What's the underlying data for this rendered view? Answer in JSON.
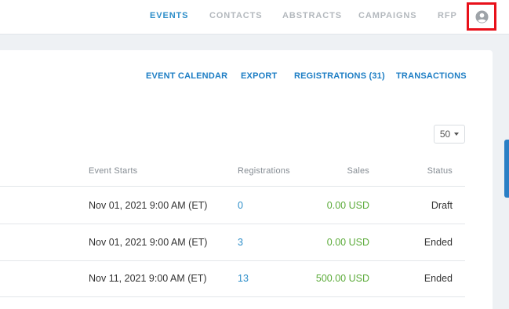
{
  "nav": {
    "items": [
      {
        "label": "EVENTS",
        "active": true
      },
      {
        "label": "CONTACTS",
        "active": false
      },
      {
        "label": "ABSTRACTS",
        "active": false
      },
      {
        "label": "CAMPAIGNS",
        "active": false
      },
      {
        "label": "RFP",
        "active": false
      }
    ],
    "account_icon": "user-avatar-icon",
    "highlight_color": "#e8101a"
  },
  "actions": [
    {
      "label": "EVENT CALENDAR"
    },
    {
      "label": "EXPORT"
    },
    {
      "label": "REGISTRATIONS (31)"
    },
    {
      "label": "TRANSACTIONS"
    }
  ],
  "page_size": {
    "value": "50"
  },
  "table": {
    "headers": {
      "event_starts": "Event Starts",
      "registrations": "Registrations",
      "sales": "Sales",
      "status": "Status"
    },
    "rows": [
      {
        "event_starts": "Nov 01, 2021 9:00 AM (ET)",
        "registrations": "0",
        "sales": "0.00 USD",
        "status": "Draft"
      },
      {
        "event_starts": "Nov 01, 2021 9:00 AM (ET)",
        "registrations": "3",
        "sales": "0.00 USD",
        "status": "Ended"
      },
      {
        "event_starts": "Nov 11, 2021 9:00 AM (ET)",
        "registrations": "13",
        "sales": "500.00 USD",
        "status": "Ended"
      }
    ]
  },
  "colors": {
    "accent": "#2d8ec9",
    "link": "#1c7dc4",
    "sales": "#5cab3a",
    "background": "#eef1f4"
  }
}
